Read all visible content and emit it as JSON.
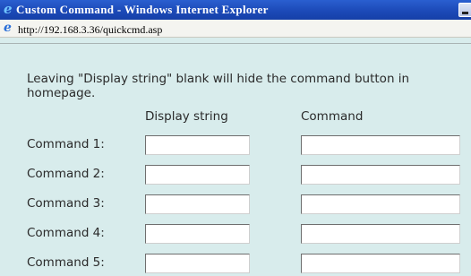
{
  "window": {
    "title": "Custom Command - Windows Internet Explorer",
    "address": "http://192.168.3.36/quickcmd.asp"
  },
  "page": {
    "note": "Leaving \"Display string\" blank will hide the command button in homepage.",
    "headers": {
      "display": "Display string",
      "command": "Command"
    },
    "rows": [
      {
        "label": "Command 1:",
        "display_value": "",
        "command_value": ""
      },
      {
        "label": "Command 2:",
        "display_value": "",
        "command_value": ""
      },
      {
        "label": "Command 3:",
        "display_value": "",
        "command_value": ""
      },
      {
        "label": "Command 4:",
        "display_value": "",
        "command_value": ""
      },
      {
        "label": "Command 5:",
        "display_value": "",
        "command_value": ""
      }
    ]
  },
  "colors": {
    "titlebar": "#1c4ab8",
    "page_background": "#d8ecec",
    "text": "#2a2a2a"
  },
  "icons": {
    "title": "internet-explorer-icon",
    "address": "internet-explorer-page-icon",
    "minimize": "minimize-icon"
  }
}
